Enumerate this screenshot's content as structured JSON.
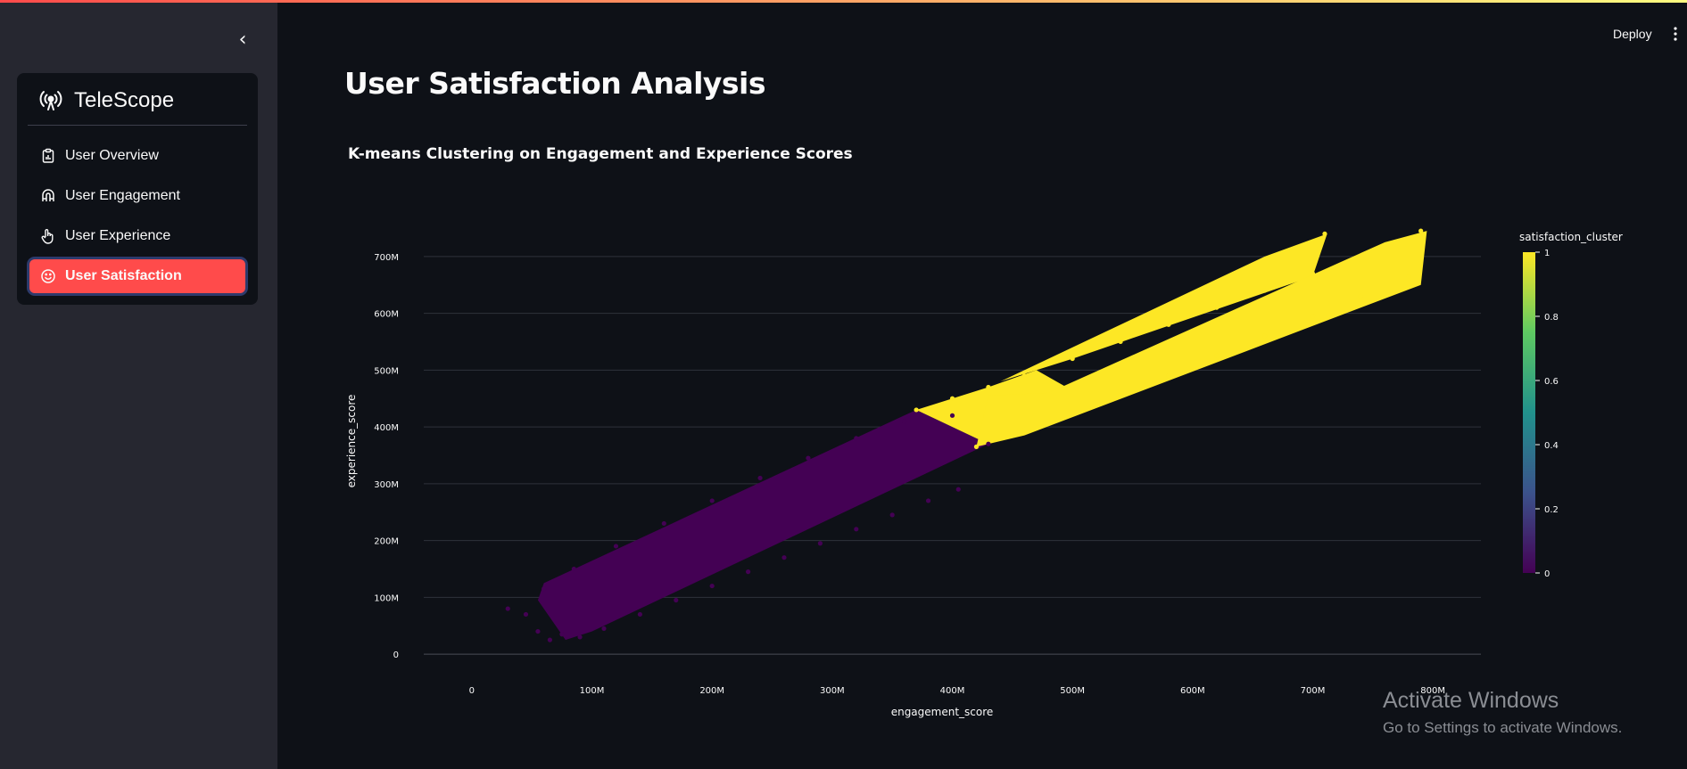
{
  "sidebar": {
    "brand": "TeleScope",
    "items": [
      {
        "label": "User Overview",
        "icon": "clipboard-icon",
        "active": false
      },
      {
        "label": "User Engagement",
        "icon": "magnet-icon",
        "active": false
      },
      {
        "label": "User Experience",
        "icon": "pointer-hand-icon",
        "active": false
      },
      {
        "label": "User Satisfaction",
        "icon": "smile-icon",
        "active": true
      }
    ]
  },
  "header": {
    "deploy_label": "Deploy"
  },
  "main": {
    "title": "User Satisfaction Analysis"
  },
  "colors": {
    "accent": "#ff4b4b",
    "viridis_low": "#440154",
    "viridis_high": "#fde725"
  },
  "chart_data": {
    "type": "scatter",
    "title": "K-means Clustering on Engagement and Experience Scores",
    "xlabel": "engagement_score",
    "ylabel": "experience_score",
    "xlim": [
      -40,
      840
    ],
    "ylim": [
      -25,
      775
    ],
    "x_ticks": [
      0,
      100,
      200,
      300,
      400,
      500,
      600,
      700,
      800
    ],
    "x_tick_labels": [
      "0",
      "100M",
      "200M",
      "300M",
      "400M",
      "500M",
      "600M",
      "700M",
      "800M"
    ],
    "y_ticks": [
      0,
      100,
      200,
      300,
      400,
      500,
      600,
      700
    ],
    "y_tick_labels": [
      "0",
      "100M",
      "200M",
      "300M",
      "400M",
      "500M",
      "600M",
      "700M"
    ],
    "grid": true,
    "colorbar": {
      "title": "satisfaction_cluster",
      "ticks": [
        0,
        0.2,
        0.4,
        0.6,
        0.8,
        1
      ],
      "tick_labels": [
        "0",
        "0.2",
        "0.4",
        "0.6",
        "0.8",
        "1"
      ]
    },
    "series": [
      {
        "cluster": 0,
        "color": "#440154",
        "x": [
          30,
          45,
          55,
          65,
          75,
          90,
          110,
          140,
          170,
          200,
          230,
          260,
          290,
          320,
          350,
          380,
          405,
          430,
          60,
          85,
          120,
          160,
          200,
          240,
          280,
          320,
          360,
          400
        ],
        "y": [
          80,
          70,
          40,
          25,
          35,
          30,
          45,
          70,
          95,
          120,
          145,
          170,
          195,
          220,
          245,
          270,
          290,
          370,
          115,
          150,
          190,
          230,
          270,
          310,
          345,
          380,
          410,
          420
        ]
      },
      {
        "cluster": 1,
        "color": "#fde725",
        "x": [
          370,
          400,
          430,
          460,
          500,
          540,
          580,
          620,
          660,
          700,
          710,
          420,
          460,
          500,
          540,
          580,
          620,
          660,
          700,
          740,
          780,
          790
        ],
        "y": [
          430,
          450,
          470,
          490,
          520,
          550,
          580,
          610,
          640,
          670,
          740,
          365,
          395,
          425,
          455,
          490,
          525,
          560,
          595,
          630,
          665,
          745
        ]
      }
    ]
  }
}
